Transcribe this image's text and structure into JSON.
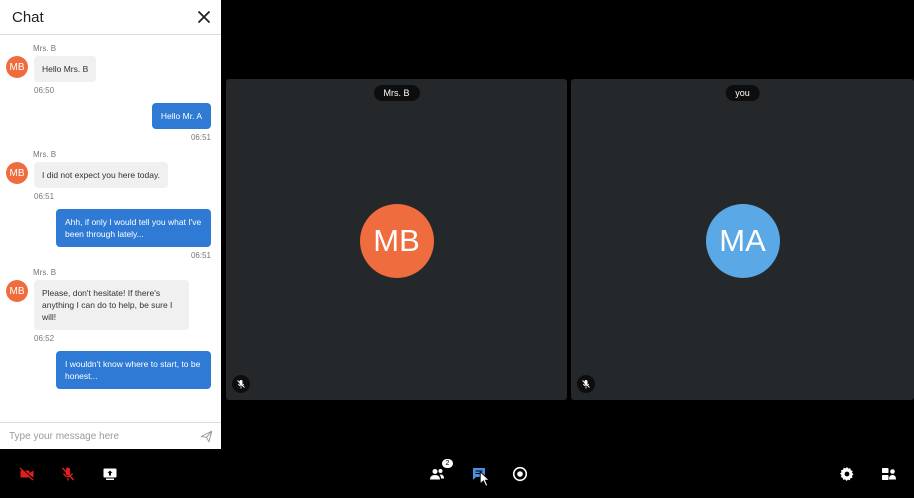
{
  "chat": {
    "title": "Chat",
    "messages": [
      {
        "dir": "in",
        "sender": "Mrs. B",
        "initials": "MB",
        "text": "Hello Mrs. B",
        "time": "06:50"
      },
      {
        "dir": "out",
        "text": "Hello Mr. A",
        "time": "06:51"
      },
      {
        "dir": "in",
        "sender": "Mrs. B",
        "initials": "MB",
        "text": "I did not expect you here today.",
        "time": "06:51"
      },
      {
        "dir": "out",
        "text": "Ahh, if only I would tell you what I've been through lately...",
        "time": "06:51"
      },
      {
        "dir": "in",
        "sender": "Mrs. B",
        "initials": "MB",
        "text": "Please, don't hesitate! If there's anything I can do to help, be sure I will!",
        "time": "06:52"
      },
      {
        "dir": "out",
        "text": "I wouldn't know where to start, to be honest...",
        "time": ""
      }
    ],
    "composer": {
      "placeholder": "Type your message here",
      "value": ""
    }
  },
  "tiles": {
    "remote": {
      "name": "Mrs. B",
      "initials": "MB",
      "color": "#ef6c3e",
      "mic": "muted-mic-icon"
    },
    "local": {
      "name": "you",
      "initials": "MA",
      "color": "#5aa9e6",
      "mic": "muted-mic-icon"
    }
  },
  "toolbar": {
    "participants_count": "2",
    "colors": {
      "danger": "#e02020",
      "active": "#4a90e2",
      "default": "#ffffff"
    }
  }
}
